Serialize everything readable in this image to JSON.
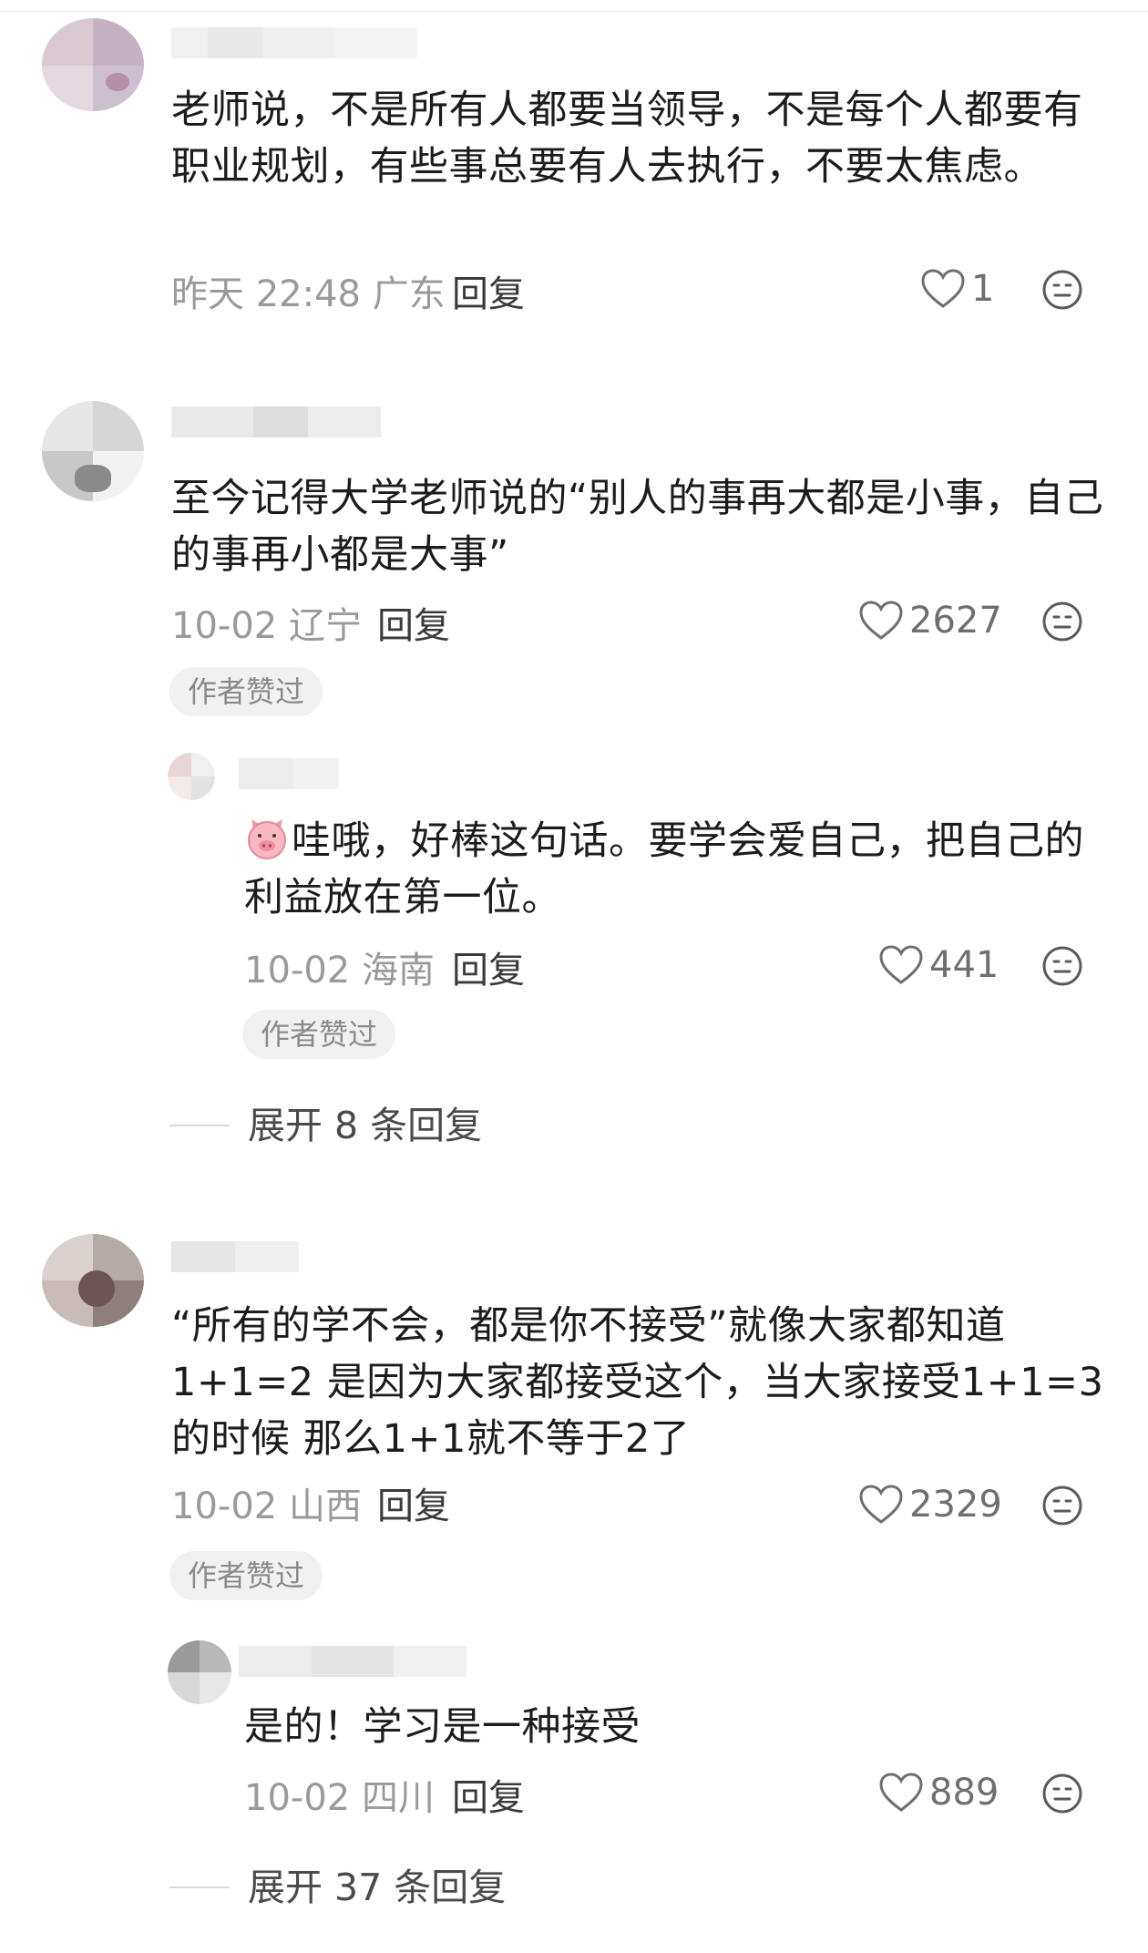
{
  "comments": [
    {
      "text": "老师说，不是所有人都要当领导，不是每个人都要有职业规划，有些事总要有人去执行，不要太焦虑。",
      "date_location": "昨天 22:48 广东",
      "reply_label": "回复",
      "likes": "1"
    },
    {
      "text": "至今记得大学老师说的“别人的事再大都是小事，自己的事再小都是大事”",
      "date_location": "10-02 辽宁",
      "reply_label": "回复",
      "likes": "2627",
      "badge": "作者赞过",
      "replies": [
        {
          "text": "哇哦，好棒这句话。要学会爱自己，把自己的利益放在第一位。",
          "date_location": "10-02 海南",
          "reply_label": "回复",
          "likes": "441",
          "badge": "作者赞过"
        }
      ],
      "expand_label": "展开 8 条回复"
    },
    {
      "text": "“所有的学不会，都是你不接受”就像大家都知道1+1=2 是因为大家都接受这个，当大家接受1+1=3的时候 那么1+1就不等于2了",
      "date_location": "10-02 山西",
      "reply_label": "回复",
      "likes": "2329",
      "badge": "作者赞过",
      "replies": [
        {
          "text": "是的！学习是一种接受",
          "date_location": "10-02 四川",
          "reply_label": "回复",
          "likes": "889"
        }
      ],
      "expand_label": "展开 37 条回复"
    }
  ],
  "icons": {
    "like": "heart-outline-icon",
    "emoji": "neutral-face-icon",
    "inline_emoji": "pig-face-emoji"
  },
  "colors": {
    "text": "#1c1c1c",
    "meta": "#9a9a9a",
    "badge_bg": "#f1f1f1"
  }
}
